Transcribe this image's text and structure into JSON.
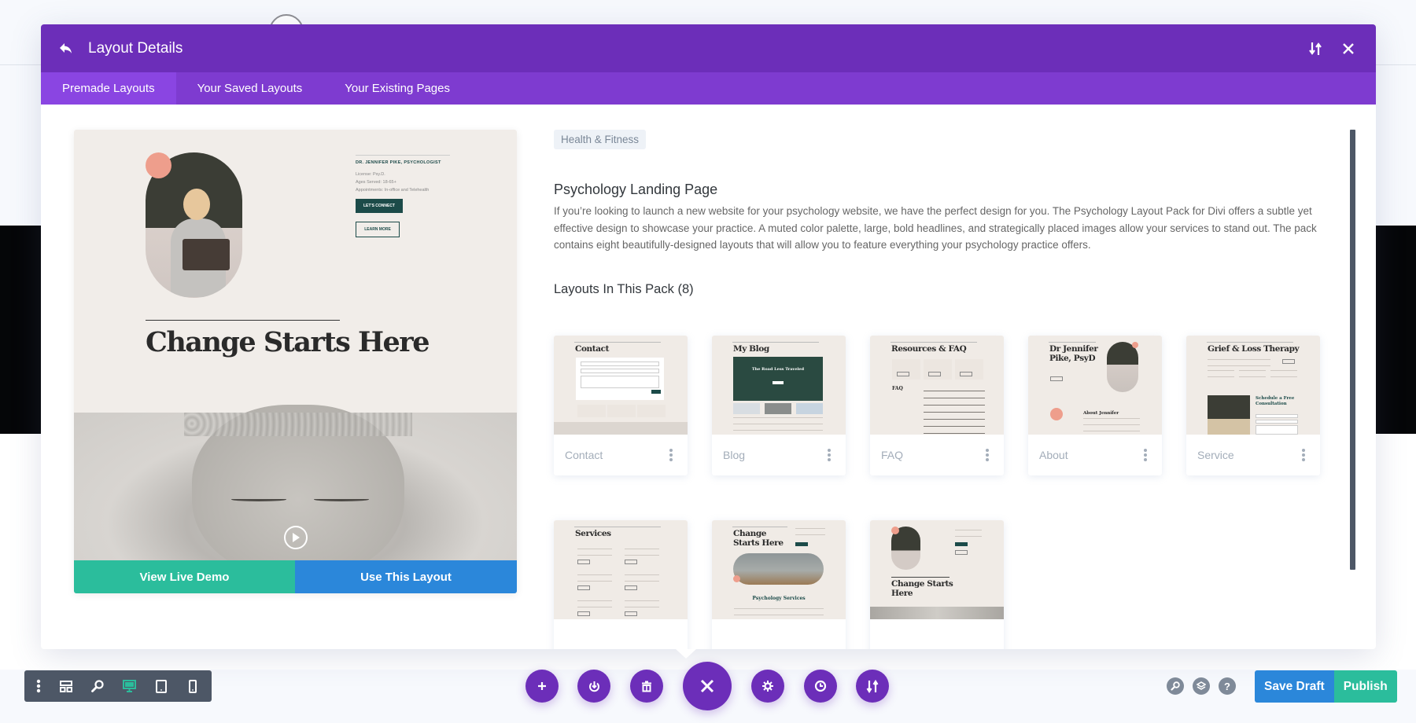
{
  "modal": {
    "title": "Layout Details",
    "tabs": [
      {
        "label": "Premade Layouts",
        "active": true
      },
      {
        "label": "Your Saved Layouts",
        "active": false
      },
      {
        "label": "Your Existing Pages",
        "active": false
      }
    ]
  },
  "preview": {
    "doctor_name": "DR. JENNIFER PIKE, PSYCHOLOGIST",
    "info_lines": [
      "License: Psy.D.",
      "Ages Served: 18-65+",
      "Appointments: In-office and Telehealth"
    ],
    "connect_label": "LET'S CONNECT",
    "learn_label": "LEARN MORE",
    "headline": "Change Starts Here",
    "view_demo_label": "View Live Demo",
    "use_layout_label": "Use This Layout"
  },
  "details": {
    "category": "Health & Fitness",
    "title": "Psychology Landing Page",
    "description": "If you’re looking to launch a new website for your psychology website, we have the perfect design for you. The Psychology Layout Pack for Divi offers a subtle yet effective design to showcase your practice. A muted color palette, large, bold headlines, and strategically placed images allow your services to stand out. The pack contains eight beautifully-designed layouts that will allow you to feature everything your psychology practice offers.",
    "pack_heading": "Layouts In This Pack (8)"
  },
  "layouts": [
    {
      "name": "Contact",
      "thumb_title": "Contact"
    },
    {
      "name": "Blog",
      "thumb_title": "My Blog",
      "thumb_banner": "The Road Less Traveled"
    },
    {
      "name": "FAQ",
      "thumb_title": "Resources & FAQ",
      "thumb_sub": "FAQ"
    },
    {
      "name": "About",
      "thumb_title": "Dr Jennifer Pike, PsyD",
      "thumb_sub": "About Jennifer"
    },
    {
      "name": "Service",
      "thumb_title": "Grief & Loss Therapy",
      "thumb_sub": "Schedule a Free Consultation"
    },
    {
      "name": "",
      "thumb_title": "Services"
    },
    {
      "name": "",
      "thumb_title": "Change Starts Here",
      "thumb_sub": "Psychology Services"
    },
    {
      "name": "",
      "thumb_title": "Change Starts Here"
    }
  ],
  "toolbar": {
    "left_icons": [
      "more-vertical-icon",
      "wireframe-icon",
      "zoom-icon",
      "desktop-icon",
      "tablet-icon",
      "phone-icon"
    ],
    "active_view": "desktop",
    "center_icons": [
      "add-icon",
      "load-icon",
      "trash-icon",
      "close-icon",
      "settings-icon",
      "history-icon",
      "portability-icon"
    ],
    "help_label": "?",
    "save_draft_label": "Save Draft",
    "publish_label": "Publish"
  },
  "colors": {
    "header": "#6c2eb9",
    "tabs": "#7e3bd0",
    "tab_active": "#8a45e2",
    "green": "#2bbd9c",
    "blue": "#2b87da",
    "toolbar": "#4d5766"
  }
}
